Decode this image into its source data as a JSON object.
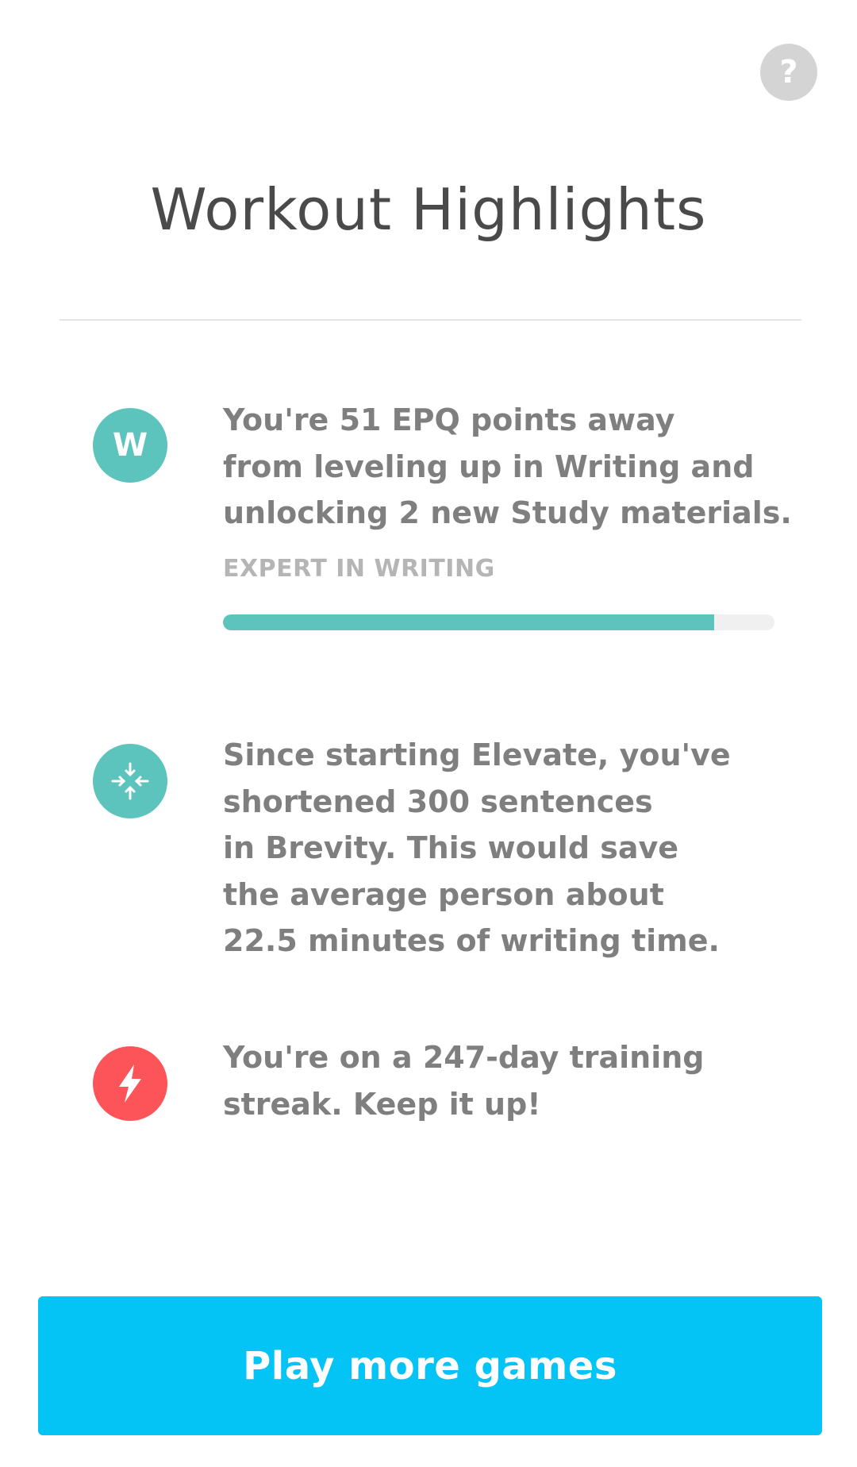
{
  "header": {
    "help_icon": "question-mark-icon",
    "help_glyph": "?",
    "title": "Workout Highlights"
  },
  "highlights": [
    {
      "icon": "writing-w-icon",
      "icon_letter": "W",
      "icon_color": "#5dc3bd",
      "lines": [
        "You're 51 EPQ points away",
        "from leveling up in Writing and",
        "unlocking 2 new Study materials."
      ],
      "label": "EXPERT IN WRITING",
      "progress": 0.89
    },
    {
      "icon": "brevity-compress-icon",
      "icon_color": "#5dc3bd",
      "lines": [
        "Since starting Elevate, you've",
        "shortened 300 sentences",
        "in Brevity. This would save",
        "the average person about",
        "22.5 minutes of writing time."
      ]
    },
    {
      "icon": "lightning-bolt-icon",
      "icon_color": "#fc5458",
      "lines": [
        "You're on a 247-day training",
        "streak. Keep it up!"
      ]
    }
  ],
  "cta": {
    "label": "Play more games",
    "color": "#04c3f5"
  }
}
